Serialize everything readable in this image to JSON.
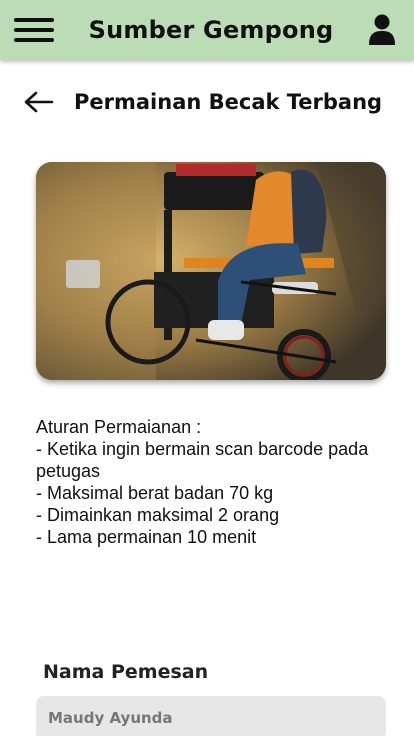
{
  "app": {
    "title": "Sumber Gempong"
  },
  "header": {
    "menu_icon": "hamburger-menu-icon",
    "user_icon": "user-icon"
  },
  "page": {
    "back_icon": "arrow-left-icon",
    "title": "Permainan Becak Terbang"
  },
  "rules": {
    "heading": "Aturan Permaianan :",
    "items": [
      "- Ketika ingin bermain scan barcode pada petugas",
      "- Maksimal berat badan 70 kg",
      "- Dimainkan maksimal 2 orang",
      "- Lama permainan 10 menit"
    ]
  },
  "form": {
    "name_label": "Nama Pemesan",
    "name_value": "Maudy Ayunda"
  },
  "colors": {
    "topbar": "#bcdcb6",
    "input_bg": "#e7e7e7"
  }
}
